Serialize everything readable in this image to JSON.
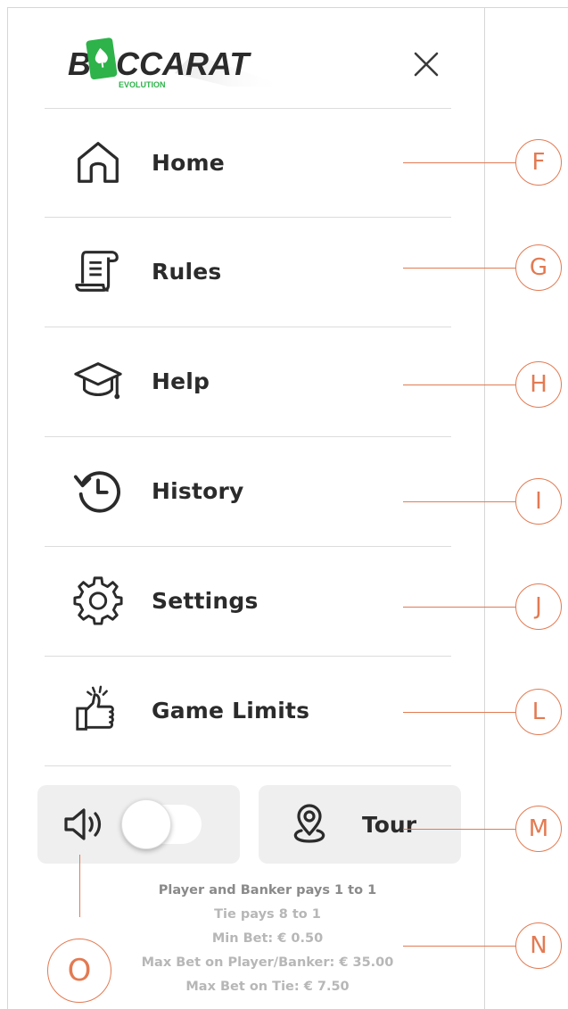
{
  "header": {
    "logo": {
      "word_prefix": "B",
      "word_suffix": "CCARAT",
      "sub_label": "EVOLUTION",
      "brand_green": "#2db34a"
    },
    "close_icon": "close-icon"
  },
  "menu": {
    "items": [
      {
        "id": "home",
        "label": "Home",
        "icon": "house-icon"
      },
      {
        "id": "rules",
        "label": "Rules",
        "icon": "scroll-document-icon"
      },
      {
        "id": "help",
        "label": "Help",
        "icon": "graduation-cap-icon"
      },
      {
        "id": "history",
        "label": "History",
        "icon": "history-clock-icon"
      },
      {
        "id": "settings",
        "label": "Settings",
        "icon": "gear-icon"
      },
      {
        "id": "game-limits",
        "label": "Game Limits",
        "icon": "thumbs-up-icon"
      }
    ]
  },
  "controls": {
    "sound": {
      "icon": "speaker-icon",
      "enabled": false
    },
    "tour": {
      "label": "Tour",
      "icon": "map-pin-icon"
    }
  },
  "limits_info": {
    "payout_main": "Player and Banker pays 1 to 1",
    "payout_tie": "Tie pays 8 to 1",
    "min_bet": "Min Bet:  € 0.50",
    "max_bet_player_banker": "Max Bet on Player/Banker:  € 35.00",
    "max_bet_tie": "Max Bet on Tie:  € 7.50"
  },
  "annotations": {
    "labels": [
      "F",
      "G",
      "H",
      "I",
      "J",
      "L",
      "M",
      "N",
      "O"
    ],
    "color": "#e37a52"
  },
  "colors": {
    "text_dark": "#2b2b2b",
    "text_muted": "#b7b7b7",
    "card_bg": "#efefef",
    "divider": "#dcdcdc"
  }
}
